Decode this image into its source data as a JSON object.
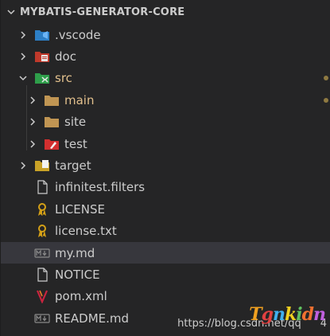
{
  "explorer": {
    "title": "MYBATIS-GENERATOR-CORE",
    "items": [
      {
        "label": ".vscode",
        "icon": "vscode-folder-icon",
        "expanded": false,
        "level": 0,
        "type": "folder"
      },
      {
        "label": "doc",
        "icon": "doc-folder-icon",
        "expanded": false,
        "level": 0,
        "type": "folder"
      },
      {
        "label": "src",
        "icon": "src-folder-icon",
        "expanded": true,
        "level": 0,
        "type": "folder",
        "modified": true
      },
      {
        "label": "main",
        "icon": "folder-icon",
        "expanded": false,
        "level": 1,
        "type": "folder",
        "modified": true
      },
      {
        "label": "site",
        "icon": "folder-icon",
        "expanded": false,
        "level": 1,
        "type": "folder"
      },
      {
        "label": "test",
        "icon": "test-folder-icon",
        "expanded": false,
        "level": 1,
        "type": "folder"
      },
      {
        "label": "target",
        "icon": "target-folder-icon",
        "expanded": false,
        "level": 0,
        "type": "folder"
      },
      {
        "label": "infinitest.filters",
        "icon": "file-icon",
        "level": 0,
        "type": "file"
      },
      {
        "label": "LICENSE",
        "icon": "license-icon",
        "level": 0,
        "type": "file"
      },
      {
        "label": "license.txt",
        "icon": "license-icon",
        "level": 0,
        "type": "file"
      },
      {
        "label": "my.md",
        "icon": "markdown-icon",
        "level": 0,
        "type": "file",
        "selected": true
      },
      {
        "label": "NOTICE",
        "icon": "file-icon",
        "level": 0,
        "type": "file"
      },
      {
        "label": "pom.xml",
        "icon": "maven-icon",
        "level": 0,
        "type": "file"
      },
      {
        "label": "README.md",
        "icon": "markdown-icon",
        "level": 0,
        "type": "file"
      }
    ]
  },
  "watermark": {
    "text": "https://blog.csdn.net/qq",
    "suffix": "4",
    "logo": "Tgnkidn"
  },
  "colors": {
    "background": "#252526",
    "selected": "#37373d",
    "text": "#cccccc",
    "modified": "#e2c08d"
  }
}
